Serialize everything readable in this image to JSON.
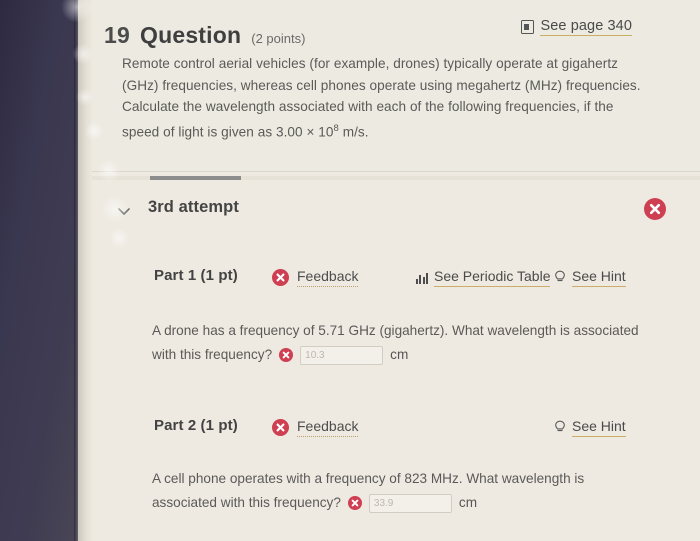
{
  "question": {
    "number": "19",
    "label": "Question",
    "points": "(2 points)",
    "see_page_label": "See page 340",
    "book_icon": "book-icon",
    "body_line_1": "Remote control aerial vehicles (for example, drones) typically operate at gigahertz (GHz)",
    "body_line_2": "frequencies, whereas cell phones operate using megahertz (MHz) frequencies. Calculate",
    "body_line_3": "the wavelength associated with each of the following frequencies, if the speed of light is",
    "body_line_4_pre": "given as 3.00 × 10",
    "body_line_4_sup": "8",
    "body_line_4_post": " m/s."
  },
  "attempt": {
    "label": "3rd attempt",
    "chevron_icon": "chevron-down-icon",
    "status_icon": "error-x-icon",
    "progress_percent": 15
  },
  "parts": [
    {
      "title": "Part 1 (1 pt)",
      "status_icon": "error-x-icon",
      "feedback_label": "Feedback",
      "periodic_label": "See Periodic Table",
      "periodic_icon": "periodic-table-icon",
      "hint_label": "See Hint",
      "hint_icon": "lightbulb-icon",
      "body_line_1": "A drone has a frequency of 5.71 GHz (gigahertz). What wavelength is associated",
      "body_line_2": "with this frequency?",
      "answer_value": "10.3",
      "answer_unit": "cm"
    },
    {
      "title": "Part 2 (1 pt)",
      "status_icon": "error-x-icon",
      "feedback_label": "Feedback",
      "hint_label": "See Hint",
      "hint_icon": "lightbulb-icon",
      "body_line_1": "A cell phone operates with a frequency of 823 MHz. What wavelength is",
      "body_line_2": "associated with this frequency?",
      "answer_value": "33.9",
      "answer_unit": "cm"
    }
  ],
  "colors": {
    "error_red": "#cf3f52",
    "link_underline": "#c9ad69",
    "page_background": "#eeeae1",
    "rail_dark": "#3a3750"
  }
}
